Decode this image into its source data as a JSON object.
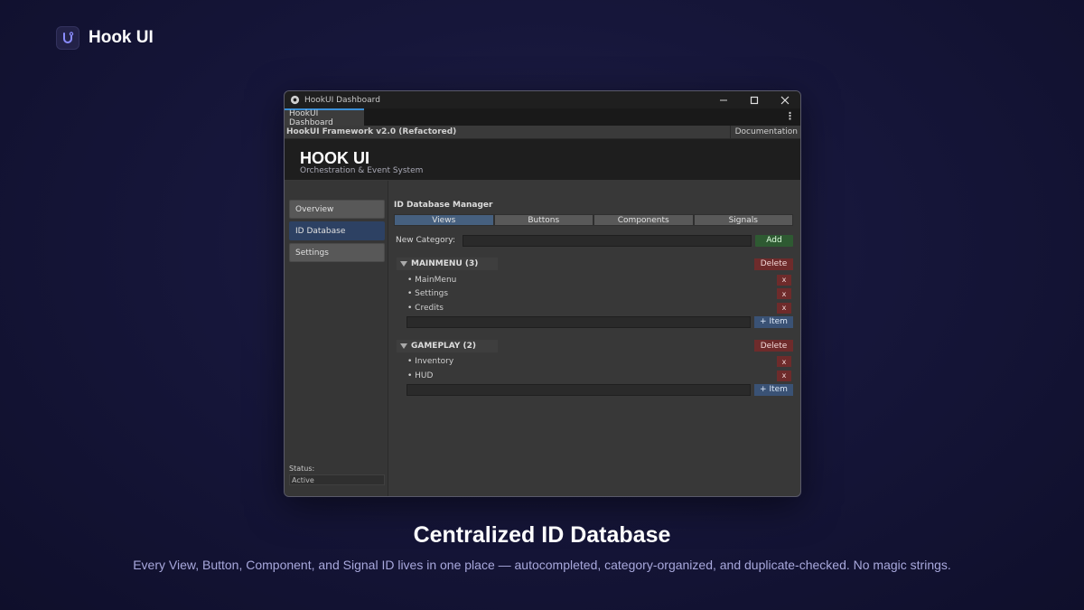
{
  "brand": {
    "name": "Hook UI",
    "logo_icon": "hook-logo-icon"
  },
  "window": {
    "title": "HookUI Dashboard",
    "tab_label": "HookUI Dashboard",
    "framework_label": "HookUI Framework v2.0 (Refactored)",
    "documentation_label": "Documentation",
    "header_title": "HOOK UI",
    "header_subtitle": "Orchestration & Event System"
  },
  "sidebar": {
    "items": [
      {
        "label": "Overview",
        "active": false
      },
      {
        "label": "ID Database",
        "active": true
      },
      {
        "label": "Settings",
        "active": false
      }
    ],
    "status_label": "Status:",
    "status_value": "Active"
  },
  "main": {
    "manager_title": "ID Database Manager",
    "tabs": [
      {
        "label": "Views",
        "active": true
      },
      {
        "label": "Buttons",
        "active": false
      },
      {
        "label": "Components",
        "active": false
      },
      {
        "label": "Signals",
        "active": false
      }
    ],
    "new_category_label": "New Category:",
    "new_category_value": "",
    "add_label": "Add",
    "delete_label": "Delete",
    "remove_label": "x",
    "add_item_label": "+ Item",
    "categories": [
      {
        "name": "MAINMENU (3)",
        "items": [
          "• MainMenu",
          "• Settings",
          "• Credits"
        ]
      },
      {
        "name": "GAMEPLAY (2)",
        "items": [
          "• Inventory",
          "• HUD"
        ]
      }
    ]
  },
  "caption": {
    "title": "Centralized ID Database",
    "subtitle": "Every View, Button, Component, and Signal ID lives in one place — autocompleted, category-organized, and duplicate-checked. No magic strings."
  },
  "colors": {
    "accent_blue": "#3b8fd6",
    "active_tab": "#46607f",
    "active_sidebar": "#2d4163",
    "add_green": "#2e5a32",
    "delete_red": "#6e2b2b"
  }
}
